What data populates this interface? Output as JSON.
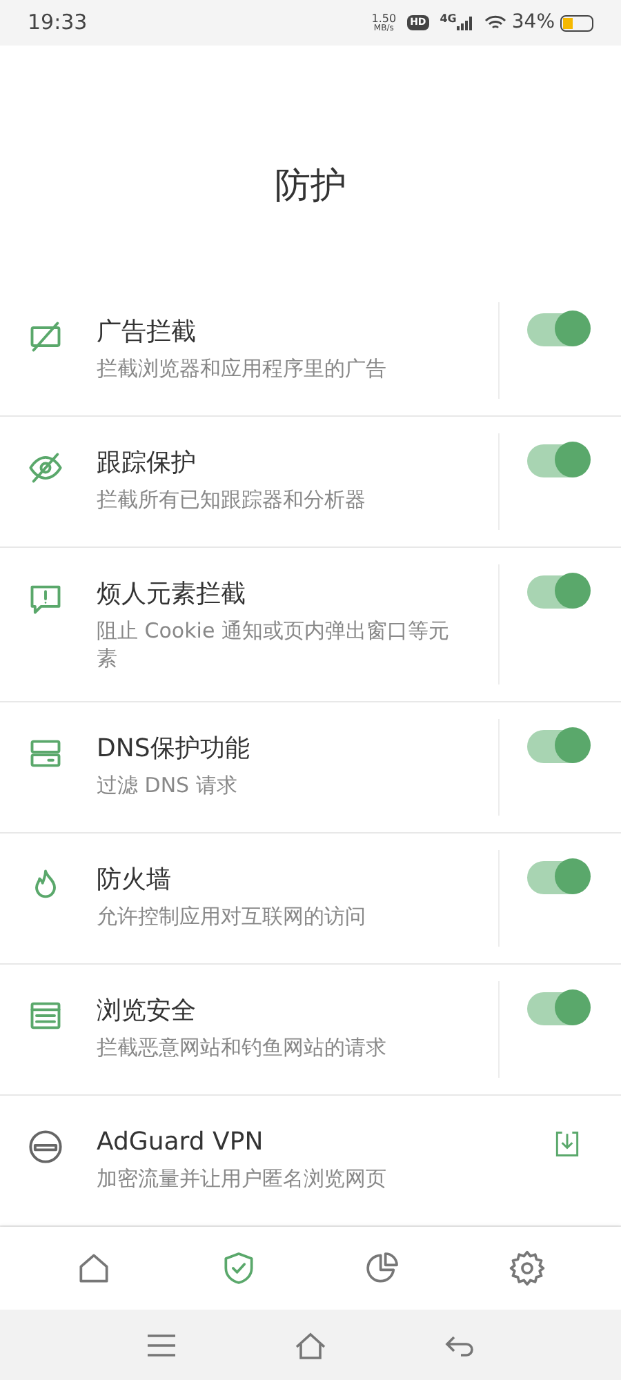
{
  "status_bar": {
    "time": "19:33",
    "speed": "1.50",
    "speed_unit": "MB/s",
    "hd": "HD",
    "network": "4G",
    "battery": "34%"
  },
  "title": "防护",
  "items": [
    {
      "kind": "toggle",
      "title": "广告拦截",
      "subtitle": "拦截浏览器和应用程序里的广告",
      "on": true
    },
    {
      "kind": "toggle",
      "title": "跟踪保护",
      "subtitle": "拦截所有已知跟踪器和分析器",
      "on": true
    },
    {
      "kind": "toggle",
      "title": "烦人元素拦截",
      "subtitle": "阻止 Cookie 通知或页内弹出窗口等元素",
      "on": true
    },
    {
      "kind": "toggle",
      "title": "DNS保护功能",
      "subtitle": "过滤 DNS 请求",
      "on": true
    },
    {
      "kind": "toggle",
      "title": "防火墙",
      "subtitle": "允许控制应用对互联网的访问",
      "on": true
    },
    {
      "kind": "toggle",
      "title": "浏览安全",
      "subtitle": "拦截恶意网站和钓鱼网站的请求",
      "on": true
    },
    {
      "kind": "download",
      "title": "AdGuard VPN",
      "subtitle": "加密流量并让用户匿名浏览网页"
    }
  ],
  "nav": [
    {
      "kind": "home",
      "selected": false
    },
    {
      "kind": "protection",
      "selected": true
    },
    {
      "kind": "stats",
      "selected": false
    },
    {
      "kind": "settings",
      "selected": false
    }
  ]
}
